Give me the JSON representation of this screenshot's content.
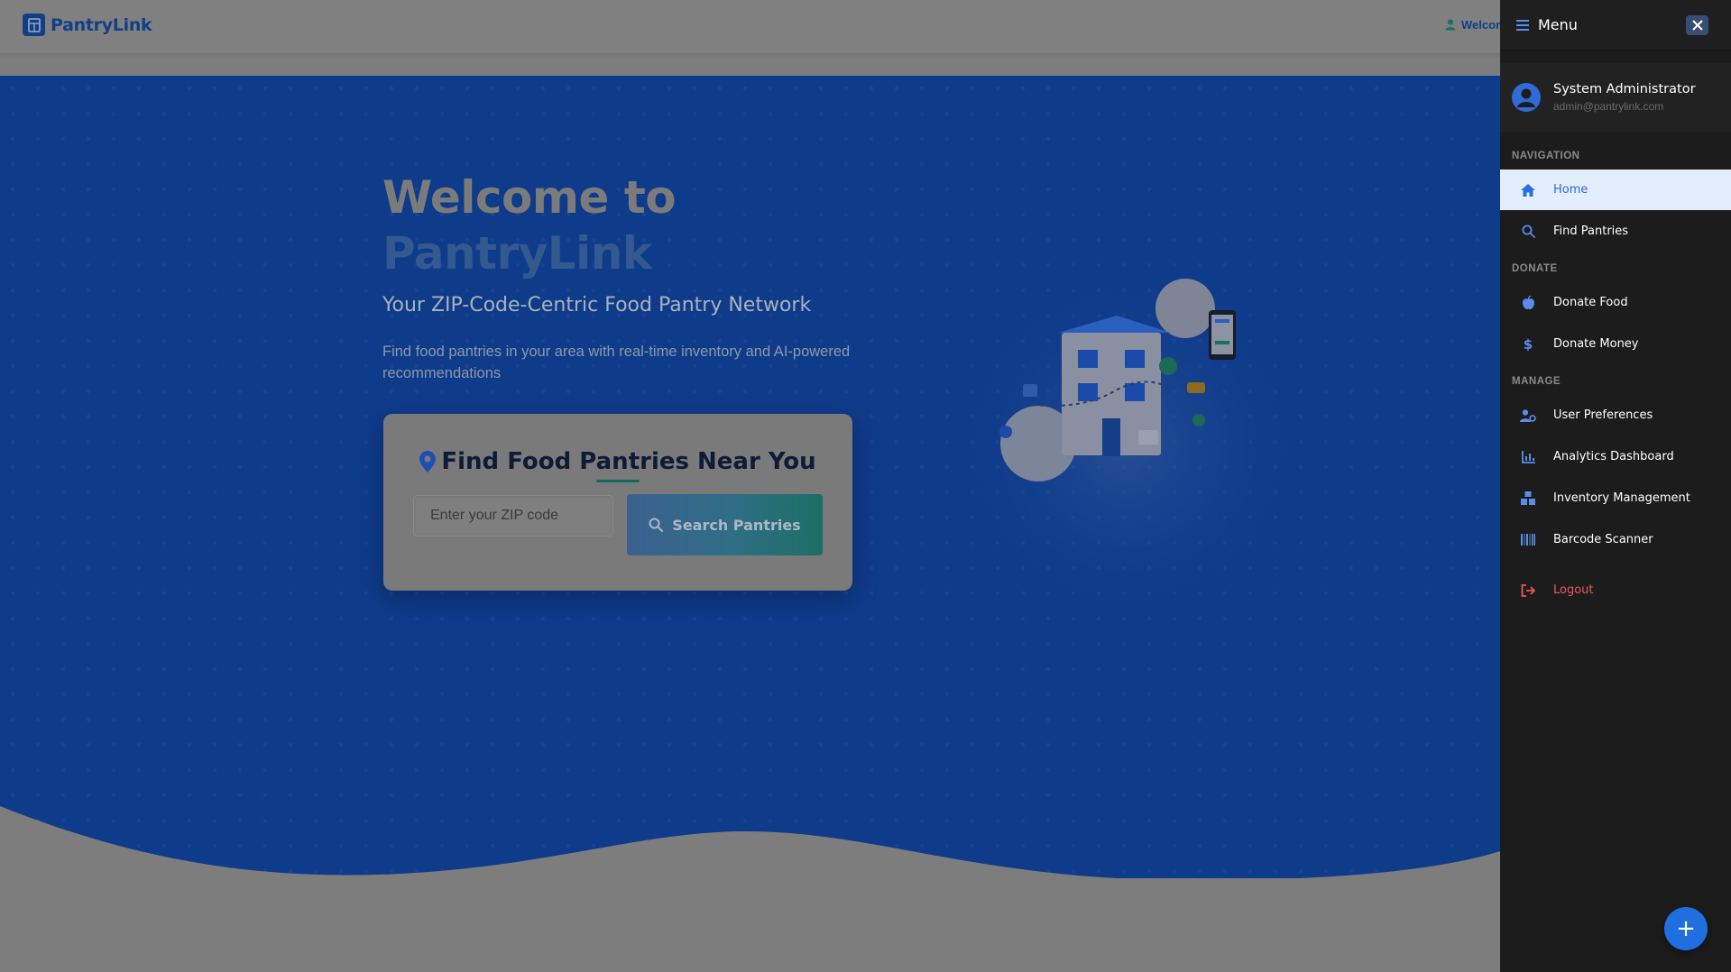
{
  "header": {
    "brand_name": "PantryLink",
    "welcome_text": "Welcome"
  },
  "hero": {
    "title_line1": "Welcome to",
    "title_line2": "PantryLink",
    "subtitle": "Your ZIP-Code-Centric Food Pantry Network",
    "description": "Find food pantries in your area with real-time inventory and AI-powered recommendations"
  },
  "search": {
    "title": "Find Food Pantries Near You",
    "zip_placeholder": "Enter your ZIP code",
    "zip_value": "",
    "button_label": "Search Pantries"
  },
  "menu": {
    "title": "Menu",
    "user": {
      "name": "System Administrator",
      "email": "admin@pantrylink.com"
    },
    "sections": {
      "navigation": "NAVIGATION",
      "donate": "DONATE",
      "manage": "MANAGE"
    },
    "items": {
      "home": "Home",
      "find_pantries": "Find Pantries",
      "donate_food": "Donate Food",
      "donate_money": "Donate Money",
      "user_preferences": "User Preferences",
      "analytics_dashboard": "Analytics Dashboard",
      "inventory_management": "Inventory Management",
      "barcode_scanner": "Barcode Scanner",
      "logout": "Logout"
    },
    "active_item": "home"
  },
  "fab": {
    "label": "+"
  },
  "colors": {
    "brand": "#123f86",
    "hero_bg": "#0f3b8b",
    "drawer_bg": "#1c1c1c",
    "accent": "#2a6ee0",
    "logout": "#e65a5a",
    "active_bg": "#e3edfc"
  }
}
